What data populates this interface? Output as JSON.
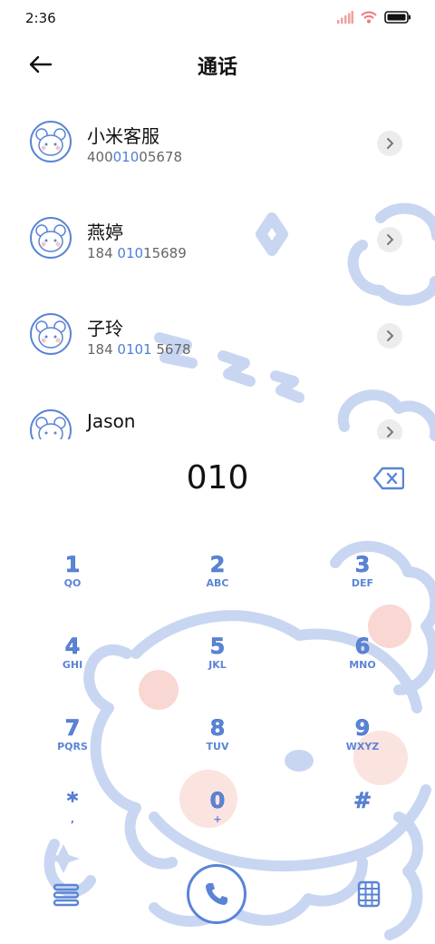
{
  "status_bar": {
    "time": "2:36",
    "signal_icon": "signal-icon",
    "wifi_icon": "wifi-icon",
    "battery_icon": "battery-icon"
  },
  "header": {
    "title": "通话",
    "back_icon": "arrow-left-icon"
  },
  "contacts": [
    {
      "name": "小米客服",
      "num_pre": "400",
      "num_hl": "010",
      "num_post": "05678"
    },
    {
      "name": "燕婷",
      "num_pre": "184 ",
      "num_hl": "010",
      "num_post": "15689"
    },
    {
      "name": "子玲",
      "num_pre": "184 ",
      "num_hl": "0101",
      "num_post": " 5678"
    },
    {
      "name": "Jason",
      "num_pre": "",
      "num_hl": "",
      "num_post": ""
    }
  ],
  "dial_input": {
    "digits": "010",
    "delete_icon": "backspace-icon"
  },
  "keypad": [
    {
      "digit": "1",
      "letters": "QO"
    },
    {
      "digit": "2",
      "letters": "ABC"
    },
    {
      "digit": "3",
      "letters": "DEF"
    },
    {
      "digit": "4",
      "letters": "GHI"
    },
    {
      "digit": "5",
      "letters": "JKL"
    },
    {
      "digit": "6",
      "letters": "MNO"
    },
    {
      "digit": "7",
      "letters": "PQRS"
    },
    {
      "digit": "8",
      "letters": "TUV"
    },
    {
      "digit": "9",
      "letters": "WXYZ"
    },
    {
      "digit": "*",
      "letters": ","
    },
    {
      "digit": "0",
      "letters": "+"
    },
    {
      "digit": "#",
      "letters": ""
    }
  ],
  "bottom_bar": {
    "menu_icon": "menu-icon",
    "call_icon": "phone-icon",
    "keypad_icon": "dialpad-icon"
  },
  "colors": {
    "accent": "#5a84d6",
    "highlight": "#4d7fd6",
    "deco": "#c8d6f2"
  }
}
